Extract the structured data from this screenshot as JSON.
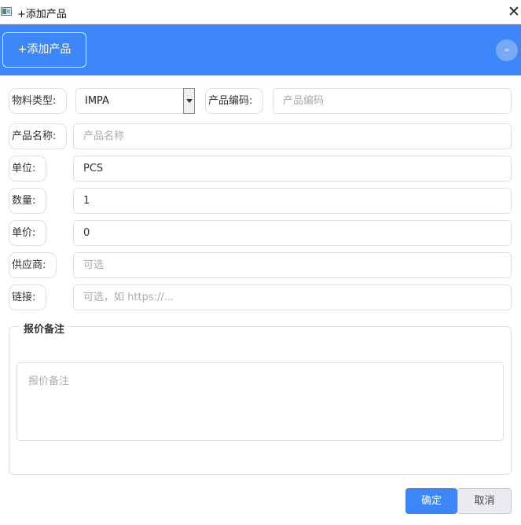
{
  "window": {
    "title": "+添加产品",
    "close_glyph": "✕"
  },
  "header": {
    "add_button_label": "+添加产品",
    "circle_glyph": "∞",
    "accent_color": "#3d86f7"
  },
  "form": {
    "material_type": {
      "label": "物料类型:",
      "selected": "IMPA"
    },
    "product_code": {
      "label": "产品编码:",
      "placeholder": "产品编码"
    },
    "product_name": {
      "label": "产品名称:",
      "placeholder": "产品名称"
    },
    "unit": {
      "label": "单位:",
      "value": "PCS"
    },
    "quantity": {
      "label": "数量:",
      "value": "1"
    },
    "unit_price": {
      "label": "单价:",
      "value": "0"
    },
    "supplier": {
      "label": "供应商:",
      "placeholder": "可选"
    },
    "link": {
      "label": "链接:",
      "placeholder": "可选，如 https://..."
    }
  },
  "quote_notes": {
    "legend": "报价备注",
    "placeholder": "报价备注"
  },
  "footer": {
    "ok_label": "确定",
    "cancel_label": "取消"
  }
}
